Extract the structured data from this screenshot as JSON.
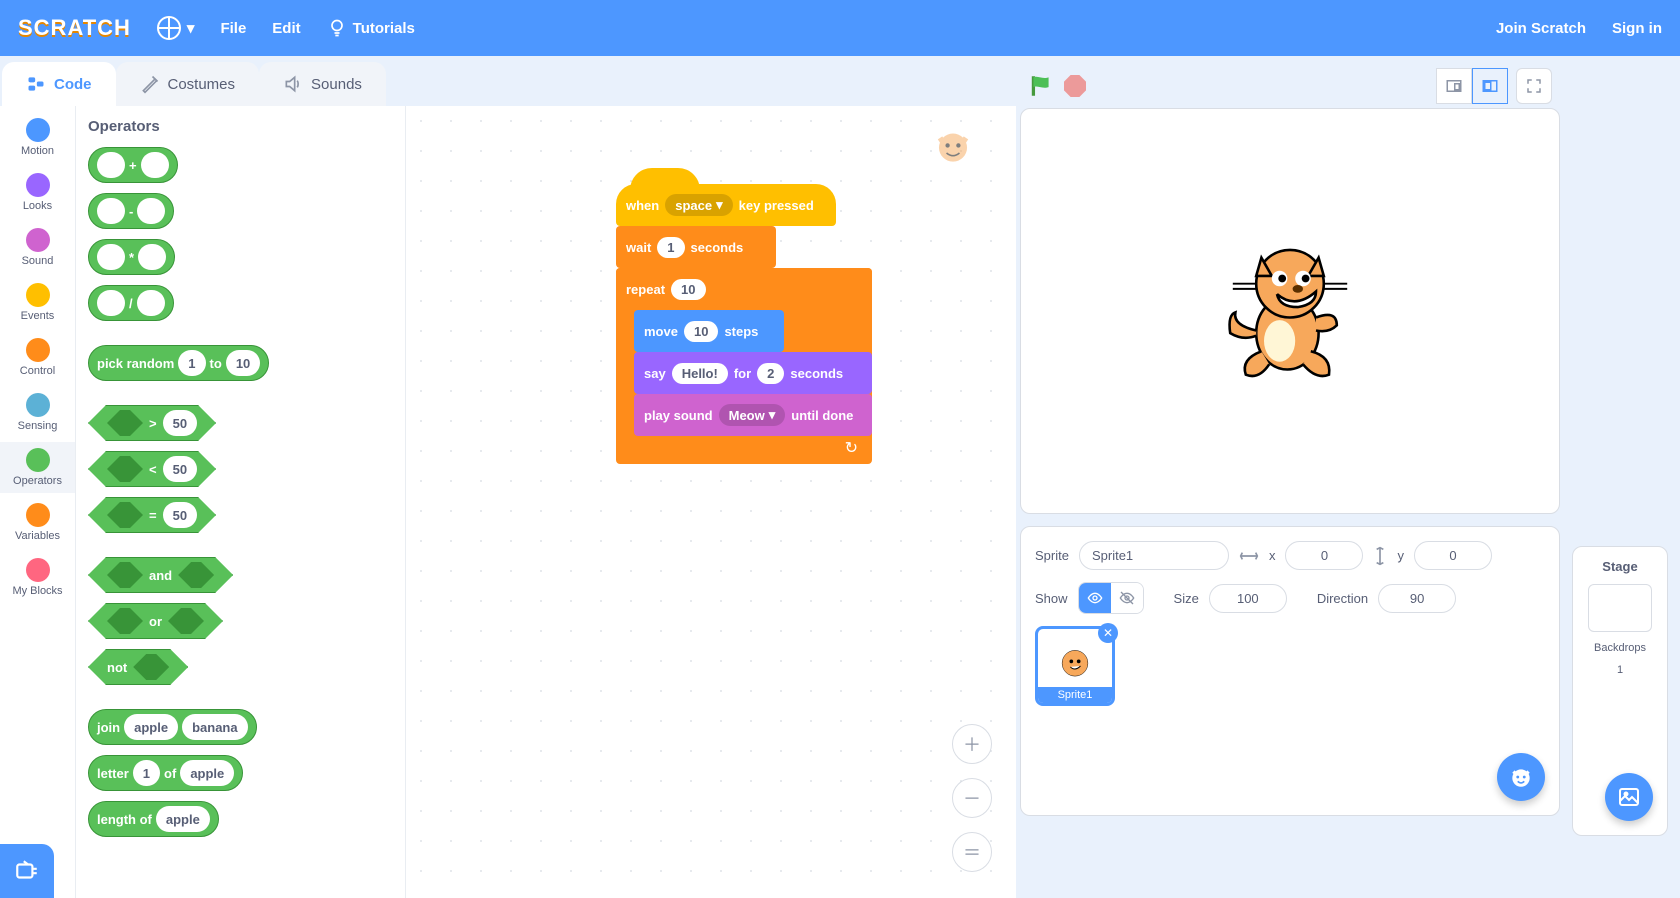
{
  "menubar": {
    "logo": "SCRATCH",
    "file": "File",
    "edit": "Edit",
    "tutorials": "Tutorials",
    "join": "Join Scratch",
    "signin": "Sign in"
  },
  "tabs": {
    "code": "Code",
    "costumes": "Costumes",
    "sounds": "Sounds"
  },
  "categories": [
    {
      "name": "Motion",
      "color": "#4c97ff"
    },
    {
      "name": "Looks",
      "color": "#9966ff"
    },
    {
      "name": "Sound",
      "color": "#cf63cf"
    },
    {
      "name": "Events",
      "color": "#ffbf00"
    },
    {
      "name": "Control",
      "color": "#ff8c1a"
    },
    {
      "name": "Sensing",
      "color": "#5cb1d6"
    },
    {
      "name": "Operators",
      "color": "#59c059"
    },
    {
      "name": "Variables",
      "color": "#ff8c1a"
    },
    {
      "name": "My Blocks",
      "color": "#ff6680"
    }
  ],
  "palette": {
    "title": "Operators",
    "ops": {
      "add": "+",
      "sub": "-",
      "mul": "*",
      "div": "/"
    },
    "pickrandom": {
      "label": "pick random",
      "a": "1",
      "to": "to",
      "b": "10"
    },
    "gt": {
      "op": ">",
      "val": "50"
    },
    "lt": {
      "op": "<",
      "val": "50"
    },
    "eq": {
      "op": "=",
      "val": "50"
    },
    "and": "and",
    "or": "or",
    "not": "not",
    "join": {
      "label": "join",
      "a": "apple",
      "b": "banana"
    },
    "letter": {
      "label": "letter",
      "n": "1",
      "of": "of",
      "s": "apple"
    },
    "length": {
      "label": "length of",
      "s": "apple"
    }
  },
  "script": {
    "when": {
      "a": "when",
      "key": "space",
      "b": "key pressed"
    },
    "wait": {
      "a": "wait",
      "n": "1",
      "b": "seconds"
    },
    "repeat": {
      "a": "repeat",
      "n": "10"
    },
    "move": {
      "a": "move",
      "n": "10",
      "b": "steps"
    },
    "say": {
      "a": "say",
      "msg": "Hello!",
      "for": "for",
      "n": "2",
      "b": "seconds"
    },
    "play": {
      "a": "play sound",
      "snd": "Meow",
      "b": "until done"
    }
  },
  "sprite": {
    "label": "Sprite",
    "name": "Sprite1",
    "xlabel": "x",
    "x": "0",
    "ylabel": "y",
    "y": "0",
    "showlabel": "Show",
    "sizelabel": "Size",
    "size": "100",
    "dirlabel": "Direction",
    "dir": "90",
    "thumb": "Sprite1"
  },
  "stage": {
    "title": "Stage",
    "backdrops": "Backdrops",
    "count": "1"
  }
}
